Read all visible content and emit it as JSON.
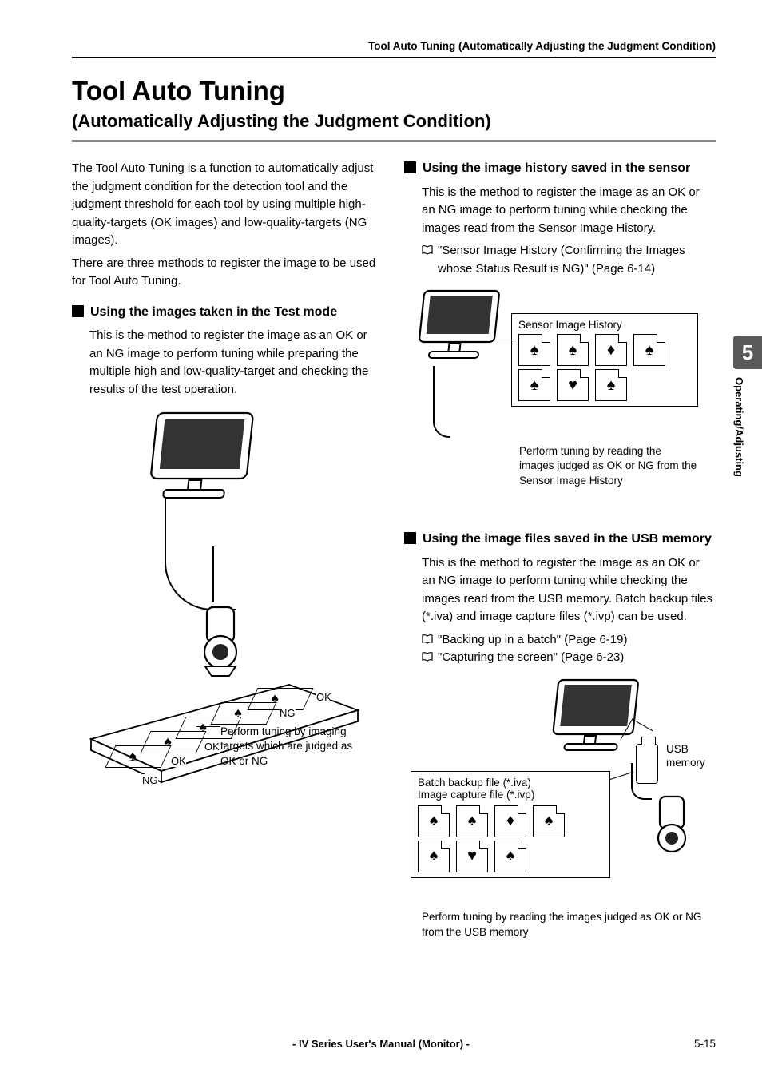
{
  "running_header": "Tool Auto Tuning (Automatically Adjusting the Judgment Condition)",
  "title": "Tool Auto Tuning",
  "subtitle": "(Automatically Adjusting the Judgment Condition)",
  "intro1": "The Tool Auto Tuning is a function to automatically adjust the judgment condition for the detection tool and the judgment threshold for each tool by using multiple high-quality-targets (OK images) and low-quality-targets (NG images).",
  "intro2": "There are three methods to register the image to be used for Tool Auto Tuning.",
  "sec1": {
    "heading": "Using the images taken in the Test mode",
    "body": "This is the method to register the image as an OK or an NG image to perform tuning while preparing the multiple high and low-quality-target and checking the results of the test operation.",
    "callout": "Perform tuning by imaging targets which are judged as OK or NG",
    "badges": {
      "ok": "OK",
      "ng": "NG"
    }
  },
  "sec2": {
    "heading": "Using the image history saved in the sensor",
    "body": "This is the method to register the image as an OK or an NG image to perform tuning while checking the images read from the Sensor Image History.",
    "ref": "\"Sensor Image History (Confirming the Images whose Status Result is NG)\" (Page 6-14)",
    "box_label": "Sensor Image History",
    "callout": "Perform tuning by reading the images judged as OK or NG from the Sensor Image History"
  },
  "sec3": {
    "heading": "Using the image files saved in the USB memory",
    "body": "This is the method to register the image as an OK or an NG image to perform tuning while checking the images read from the USB memory. Batch backup files (*.iva) and image capture files (*.ivp) can be used.",
    "ref1": "\"Backing up in a batch\" (Page 6-19)",
    "ref2": "\"Capturing the screen\" (Page 6-23)",
    "usb_label": "USB memory",
    "box_line1": "Batch backup file (*.iva)",
    "box_line2": "Image capture file (*.ivp)",
    "caption": "Perform tuning by reading the images judged as OK or NG from the USB memory"
  },
  "side_tab": {
    "num": "5",
    "label": "Operating/Adjusting"
  },
  "footer": {
    "center": "- IV Series User's Manual (Monitor) -",
    "right": "5-15"
  }
}
